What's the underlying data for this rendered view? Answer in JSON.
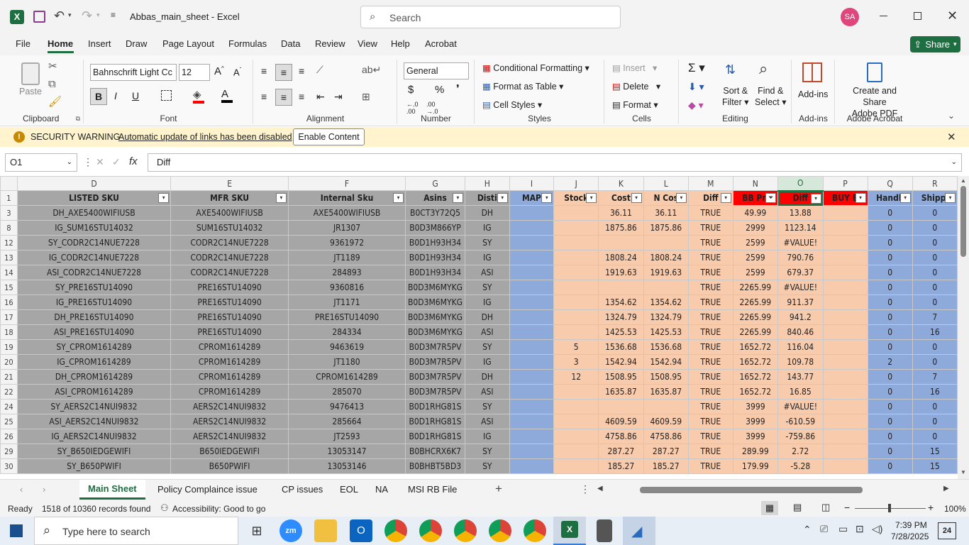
{
  "app": {
    "title": "Abbas_main_sheet  -  Excel",
    "search_placeholder": "Search",
    "user_initials": "SA",
    "share_label": "Share"
  },
  "menu": [
    "File",
    "Home",
    "Insert",
    "Draw",
    "Page Layout",
    "Formulas",
    "Data",
    "Review",
    "View",
    "Help",
    "Acrobat"
  ],
  "ribbon": {
    "clipboard": {
      "paste": "Paste",
      "label": "Clipboard"
    },
    "font": {
      "name": "Bahnschrift Light Cc",
      "size": "12",
      "label": "Font"
    },
    "alignment": {
      "label": "Alignment"
    },
    "number": {
      "format": "General",
      "label": "Number"
    },
    "styles": {
      "cond": "Conditional Formatting",
      "table": "Format as Table",
      "cell": "Cell Styles",
      "label": "Styles"
    },
    "cells": {
      "insert": "Insert",
      "delete": "Delete",
      "format": "Format",
      "label": "Cells"
    },
    "editing": {
      "sort": "Sort &",
      "sort2": "Filter",
      "find": "Find &",
      "find2": "Select",
      "label": "Editing"
    },
    "addins": {
      "btn": "Add-ins",
      "label": "Add-ins"
    },
    "acrobat": {
      "btn": "Create and Share",
      "btn2": "Adobe PDF",
      "label": "Adobe Acrobat"
    }
  },
  "security": {
    "title": "SECURITY WARNING",
    "message": "Automatic update of links has been disabled",
    "button": "Enable Content"
  },
  "formula_bar": {
    "name_box": "O1",
    "content": "Diff"
  },
  "columns": [
    "D",
    "E",
    "F",
    "G",
    "H",
    "I",
    "J",
    "K",
    "L",
    "M",
    "N",
    "O",
    "P",
    "Q",
    "R"
  ],
  "headers": [
    "LISTED SKU",
    "MFR SKU",
    "Internal Sku",
    "Asins",
    "Disti",
    "MAP",
    "Stock",
    "Cost",
    "N Cos",
    "Diff",
    "BB Pri",
    "Diff",
    "BUY B",
    "Handli",
    "Shippi"
  ],
  "rows": [
    {
      "n": "3",
      "c": [
        "DH_AXE5400WIFIUSB",
        "AXE5400WIFIUSB",
        "AXE5400WIFIUSB",
        "B0CT3Y72Q5",
        "DH",
        "",
        "",
        "36.11",
        "36.11",
        "TRUE",
        "49.99",
        "13.88",
        "",
        "0",
        "0"
      ]
    },
    {
      "n": "8",
      "c": [
        "IG_SUM16STU14032",
        "SUM16STU14032",
        "JR1307",
        "B0D3M866YP",
        "IG",
        "",
        "",
        "1875.86",
        "1875.86",
        "TRUE",
        "2999",
        "1123.14",
        "",
        "0",
        "0"
      ]
    },
    {
      "n": "12",
      "c": [
        "SY_CODR2C14NUE7228",
        "CODR2C14NUE7228",
        "9361972",
        "B0D1H93H34",
        "SY",
        "",
        "",
        "",
        "",
        "TRUE",
        "2599",
        "#VALUE!",
        "",
        "0",
        "0"
      ]
    },
    {
      "n": "13",
      "c": [
        "IG_CODR2C14NUE7228",
        "CODR2C14NUE7228",
        "JT1189",
        "B0D1H93H34",
        "IG",
        "",
        "",
        "1808.24",
        "1808.24",
        "TRUE",
        "2599",
        "790.76",
        "",
        "0",
        "0"
      ]
    },
    {
      "n": "14",
      "c": [
        "ASI_CODR2C14NUE7228",
        "CODR2C14NUE7228",
        "284893",
        "B0D1H93H34",
        "ASI",
        "",
        "",
        "1919.63",
        "1919.63",
        "TRUE",
        "2599",
        "679.37",
        "",
        "0",
        "0"
      ]
    },
    {
      "n": "15",
      "c": [
        "SY_PRE16STU14090",
        "PRE16STU14090",
        "9360816",
        "B0D3M6MYKG",
        "SY",
        "",
        "",
        "",
        "",
        "TRUE",
        "2265.99",
        "#VALUE!",
        "",
        "0",
        "0"
      ]
    },
    {
      "n": "16",
      "c": [
        "IG_PRE16STU14090",
        "PRE16STU14090",
        "JT1171",
        "B0D3M6MYKG",
        "IG",
        "",
        "",
        "1354.62",
        "1354.62",
        "TRUE",
        "2265.99",
        "911.37",
        "",
        "0",
        "0"
      ]
    },
    {
      "n": "17",
      "c": [
        "DH_PRE16STU14090",
        "PRE16STU14090",
        "PRE16STU14090",
        "B0D3M6MYKG",
        "DH",
        "",
        "",
        "1324.79",
        "1324.79",
        "TRUE",
        "2265.99",
        "941.2",
        "",
        "0",
        "7"
      ]
    },
    {
      "n": "18",
      "c": [
        "ASI_PRE16STU14090",
        "PRE16STU14090",
        "284334",
        "B0D3M6MYKG",
        "ASI",
        "",
        "",
        "1425.53",
        "1425.53",
        "TRUE",
        "2265.99",
        "840.46",
        "",
        "0",
        "16"
      ]
    },
    {
      "n": "19",
      "c": [
        "SY_CPROM1614289",
        "CPROM1614289",
        "9463619",
        "B0D3M7R5PV",
        "SY",
        "",
        "5",
        "1536.68",
        "1536.68",
        "TRUE",
        "1652.72",
        "116.04",
        "",
        "0",
        "0"
      ]
    },
    {
      "n": "20",
      "c": [
        "IG_CPROM1614289",
        "CPROM1614289",
        "JT1180",
        "B0D3M7R5PV",
        "IG",
        "",
        "3",
        "1542.94",
        "1542.94",
        "TRUE",
        "1652.72",
        "109.78",
        "",
        "2",
        "0"
      ]
    },
    {
      "n": "21",
      "c": [
        "DH_CPROM1614289",
        "CPROM1614289",
        "CPROM1614289",
        "B0D3M7R5PV",
        "DH",
        "",
        "12",
        "1508.95",
        "1508.95",
        "TRUE",
        "1652.72",
        "143.77",
        "",
        "0",
        "7"
      ]
    },
    {
      "n": "22",
      "c": [
        "ASI_CPROM1614289",
        "CPROM1614289",
        "285070",
        "B0D3M7R5PV",
        "ASI",
        "",
        "",
        "1635.87",
        "1635.87",
        "TRUE",
        "1652.72",
        "16.85",
        "",
        "0",
        "16"
      ]
    },
    {
      "n": "24",
      "c": [
        "SY_AERS2C14NUI9832",
        "AERS2C14NUI9832",
        "9476413",
        "B0D1RHG81S",
        "SY",
        "",
        "",
        "",
        "",
        "TRUE",
        "3999",
        "#VALUE!",
        "",
        "0",
        "0"
      ]
    },
    {
      "n": "25",
      "c": [
        "ASI_AERS2C14NUI9832",
        "AERS2C14NUI9832",
        "285664",
        "B0D1RHG81S",
        "ASI",
        "",
        "",
        "4609.59",
        "4609.59",
        "TRUE",
        "3999",
        "-610.59",
        "",
        "0",
        "0"
      ]
    },
    {
      "n": "26",
      "c": [
        "IG_AERS2C14NUI9832",
        "AERS2C14NUI9832",
        "JT2593",
        "B0D1RHG81S",
        "IG",
        "",
        "",
        "4758.86",
        "4758.86",
        "TRUE",
        "3999",
        "-759.86",
        "",
        "0",
        "0"
      ]
    },
    {
      "n": "29",
      "c": [
        "SY_B650IEDGEWIFI",
        "B650IEDGEWIFI",
        "13053147",
        "B0BHCRX6K7",
        "SY",
        "",
        "",
        "287.27",
        "287.27",
        "TRUE",
        "289.99",
        "2.72",
        "",
        "0",
        "15"
      ]
    },
    {
      "n": "30",
      "c": [
        "SY_B650PWIFI",
        "B650PWIFI",
        "13053146",
        "B0BHBT5BD3",
        "SY",
        "",
        "",
        "185.27",
        "185.27",
        "TRUE",
        "179.99",
        "-5.28",
        "",
        "0",
        "15"
      ]
    }
  ],
  "sheets": [
    "Main Sheet",
    "Policy Complaince issue",
    "CP issues",
    "EOL",
    "NA",
    "MSI RB File"
  ],
  "status": {
    "ready": "Ready",
    "records": "1518 of 10360 records found",
    "accessibility": "Accessibility: Good to go",
    "zoom": "100%"
  },
  "taskbar": {
    "search_placeholder": "Type here to search",
    "time": "7:39 PM",
    "date": "7/28/2025",
    "notif": "24"
  }
}
